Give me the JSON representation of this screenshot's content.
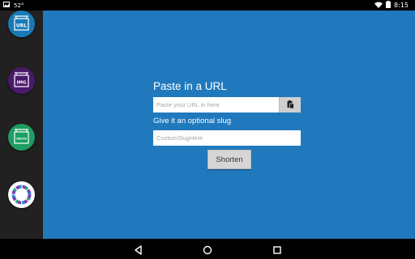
{
  "status_bar": {
    "notification_badge": "52°",
    "time": "8:15",
    "icons": [
      "image-notification-icon",
      "wifi-icon",
      "battery-icon"
    ]
  },
  "sidebar": {
    "items": [
      {
        "name": "url",
        "label": "URL",
        "color": "#1a7ab8"
      },
      {
        "name": "img",
        "label": "IMG",
        "color": "#4a1a6a"
      },
      {
        "name": "paste",
        "label": "PASTE",
        "color": "#1e9e62"
      },
      {
        "name": "other",
        "label": "",
        "color": "#ffffff"
      }
    ]
  },
  "main": {
    "heading": "Paste in a URL",
    "url_placeholder": "Paste your URL in here",
    "slug_label": "Give it an optional slug",
    "slug_placeholder": "CustomSlugHere",
    "shorten_label": "Shorten"
  },
  "colors": {
    "main_bg": "#2179bd",
    "sidebar_bg": "#212121"
  },
  "nav_bar": {
    "icons": [
      "back-icon",
      "home-icon",
      "recents-icon"
    ]
  }
}
